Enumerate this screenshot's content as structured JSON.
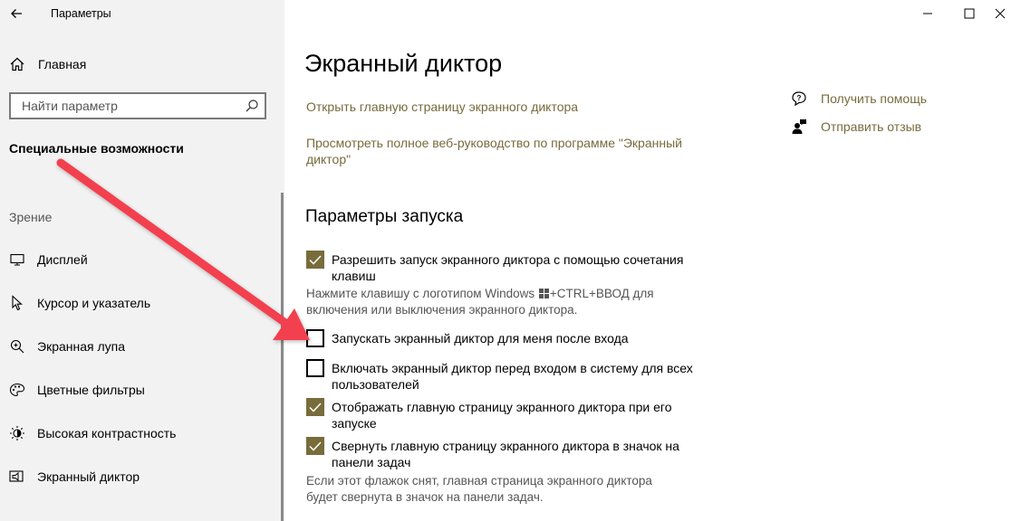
{
  "window": {
    "title": "Параметры"
  },
  "sidebar": {
    "home_label": "Главная",
    "search_placeholder": "Найти параметр",
    "section_title": "Специальные возможности",
    "group_label": "Зрение",
    "items": [
      {
        "label": "Дисплей",
        "icon": "display-icon"
      },
      {
        "label": "Курсор и указатель",
        "icon": "cursor-icon"
      },
      {
        "label": "Экранная лупа",
        "icon": "magnifier-icon"
      },
      {
        "label": "Цветные фильтры",
        "icon": "palette-icon"
      },
      {
        "label": "Высокая контрастность",
        "icon": "contrast-icon"
      },
      {
        "label": "Экранный диктор",
        "icon": "narrator-icon"
      }
    ]
  },
  "main": {
    "title": "Экранный диктор",
    "links": [
      "Открыть главную страницу экранного диктора",
      "Просмотреть полное веб-руководство по программе \"Экранный диктор\""
    ],
    "startup_heading": "Параметры запуска",
    "options": [
      {
        "label": "Разрешить запуск экранного диктора с помощью сочетания клавиш",
        "checked": true
      },
      {
        "label": "Запускать экранный диктор для меня после входа",
        "checked": false
      },
      {
        "label": "Включать экранный диктор перед входом в систему для всех пользователей",
        "checked": false
      },
      {
        "label": "Отображать главную страницу экранного диктора при его запуске",
        "checked": true
      },
      {
        "label": "Свернуть главную страницу экранного диктора в значок на панели задач",
        "checked": true
      }
    ],
    "shortcut_note_pre": "Нажмите клавишу с логотипом Windows",
    "shortcut_note_post": "+CTRL+ВВОД для включения или выключения экранного диктора.",
    "minimize_note": "Если этот флажок снят, главная страница экранного диктора будет свернута в значок на панели задач."
  },
  "help": {
    "get_help": "Получить помощь",
    "feedback": "Отправить отзыв"
  },
  "colors": {
    "accent": "#786c3b",
    "arrow": "#f2404f"
  }
}
